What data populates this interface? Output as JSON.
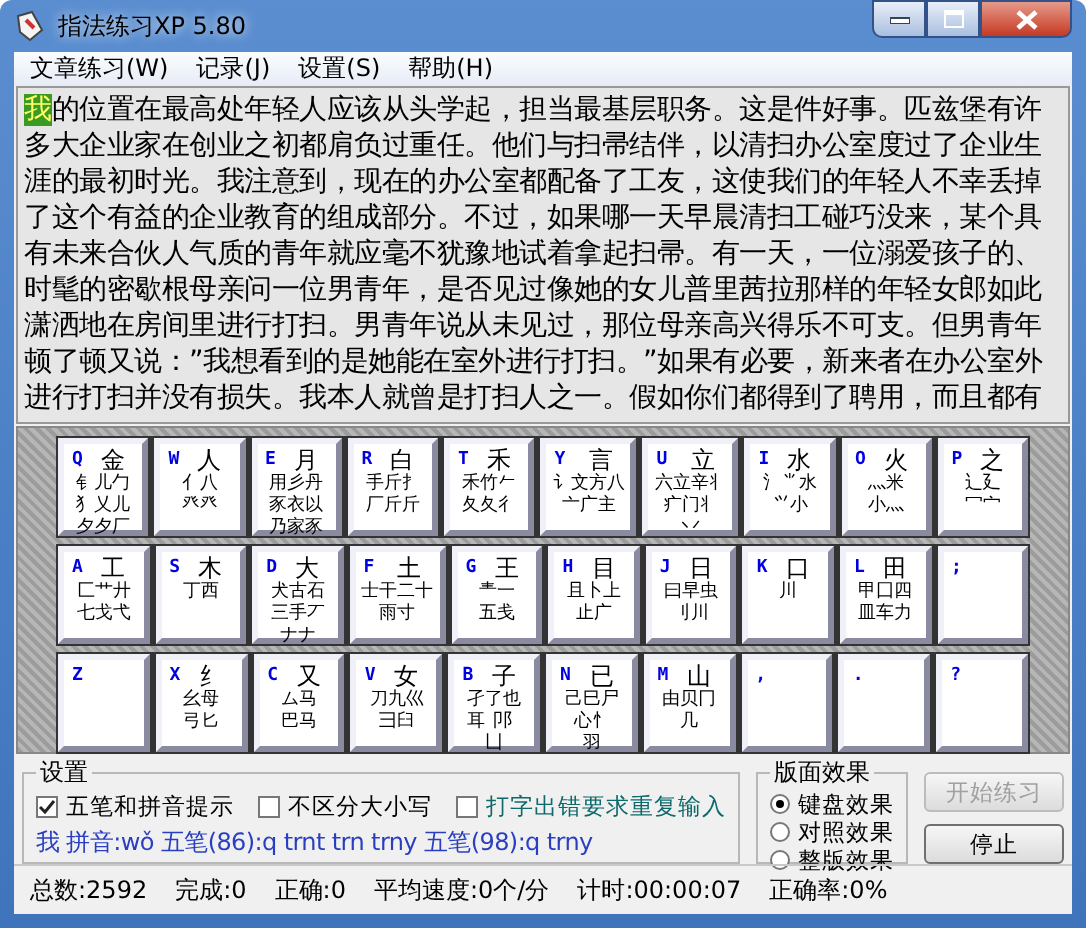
{
  "window": {
    "title": "指法练习XP 5.80"
  },
  "menu": [
    "文章练习(W)",
    "记录(J)",
    "设置(S)",
    "帮助(H)"
  ],
  "text": {
    "current": "我",
    "rest": "的位置在最高处年轻人应该从头学起，担当最基层职务。这是件好事。匹兹堡有许多大企业家在创业之初都肩负过重任。他们与扫帚结伴，以清扫办公室度过了企业生涯的最初时光。我注意到，现在的办公室都配备了工友，这使我们的年轻人不幸丢掉了这个有益的企业教育的组成部分。不过，如果哪一天早晨清扫工碰巧没来，某个具有未来合伙人气质的青年就应毫不犹豫地试着拿起扫帚。有一天，一位溺爱孩子的、时髦的密歇根母亲问一位男青年，是否见过像她的女儿普里茜拉那样的年轻女郎如此潇洒地在房间里进行打扫。男青年说从未见过，那位母亲高兴得乐不可支。但男青年顿了顿又说：”我想看到的是她能在室外进行打扫。”如果有必要，新来者在办公室外进行打扫并没有损失。我本人就曾是打扫人之一。假如你们都得到了聘用，而且都有"
  },
  "keyboard": [
    [
      {
        "key": "Q",
        "main": "金",
        "lines": [
          "钅儿勹",
          "犭乂儿",
          "夕夕厂"
        ]
      },
      {
        "key": "W",
        "main": "人",
        "lines": [
          "亻八",
          "癶癶"
        ]
      },
      {
        "key": "E",
        "main": "月",
        "lines": [
          "用彡丹",
          "豕衣以",
          "乃家豕"
        ]
      },
      {
        "key": "R",
        "main": "白",
        "lines": [
          "手斤扌",
          "厂斤斤"
        ]
      },
      {
        "key": "T",
        "main": "禾",
        "lines": [
          "禾竹𠂉",
          "夂夂彳"
        ]
      },
      {
        "key": "Y",
        "main": "言",
        "lines": [
          "讠文方八",
          "亠广主"
        ]
      },
      {
        "key": "U",
        "main": "立",
        "lines": [
          "六立辛丬",
          "疒门丬",
          "丷"
        ]
      },
      {
        "key": "I",
        "main": "水",
        "lines": [
          "氵⺌水",
          "⺍小"
        ]
      },
      {
        "key": "O",
        "main": "火",
        "lines": [
          "灬米",
          "小灬"
        ]
      },
      {
        "key": "P",
        "main": "之",
        "lines": [
          "辶廴",
          "冖宀"
        ]
      }
    ],
    [
      {
        "key": "A",
        "main": "工",
        "lines": [
          "匚艹廾",
          "七戈弋"
        ]
      },
      {
        "key": "S",
        "main": "木",
        "lines": [
          "丁西"
        ]
      },
      {
        "key": "D",
        "main": "大",
        "lines": [
          "犬古石",
          "三手丆",
          "ナナ"
        ]
      },
      {
        "key": "F",
        "main": "土",
        "lines": [
          "士干二十",
          "雨寸"
        ]
      },
      {
        "key": "G",
        "main": "王",
        "lines": [
          "龶一",
          "五戋"
        ]
      },
      {
        "key": "H",
        "main": "目",
        "lines": [
          "且卜上",
          "止广"
        ]
      },
      {
        "key": "J",
        "main": "日",
        "lines": [
          "曰早虫",
          "刂川"
        ]
      },
      {
        "key": "K",
        "main": "口",
        "lines": [
          "川"
        ]
      },
      {
        "key": "L",
        "main": "田",
        "lines": [
          "甲囗四",
          "皿车力"
        ]
      },
      {
        "key": ";"
      }
    ],
    [
      {
        "key": "Z"
      },
      {
        "key": "X",
        "main": "纟",
        "lines": [
          "幺母",
          "弓匕"
        ]
      },
      {
        "key": "C",
        "main": "又",
        "lines": [
          "ム马",
          "巴马"
        ]
      },
      {
        "key": "V",
        "main": "女",
        "lines": [
          "刀九巛",
          "彐臼"
        ]
      },
      {
        "key": "B",
        "main": "子",
        "lines": [
          "孑了也",
          "耳卩阝",
          "凵"
        ]
      },
      {
        "key": "N",
        "main": "已",
        "lines": [
          "己巳尸",
          "心忄",
          "羽"
        ]
      },
      {
        "key": "M",
        "main": "山",
        "lines": [
          "由贝冂",
          "几"
        ]
      },
      {
        "key": ","
      },
      {
        "key": "."
      },
      {
        "key": "?"
      }
    ]
  ],
  "settings": {
    "title": "设置",
    "options": [
      {
        "label": "五笔和拼音提示",
        "checked": true,
        "kind": "plain"
      },
      {
        "label": "不区分大小写",
        "checked": false,
        "kind": "plain"
      },
      {
        "label": "打字出错要求重复输入",
        "checked": false,
        "kind": "accent"
      }
    ],
    "hint": "我 拼音:wǒ 五笔(86):q trnt trn trny 五笔(98):q trny"
  },
  "effects": {
    "title": "版面效果",
    "options": [
      {
        "label": "键盘效果",
        "selected": true
      },
      {
        "label": "对照效果",
        "selected": false
      },
      {
        "label": "整版效果",
        "selected": false
      }
    ]
  },
  "buttons": [
    {
      "label": "开始练习",
      "disabled": true
    },
    {
      "label": "停止",
      "disabled": false
    }
  ],
  "status_bar": [
    "总数:2592",
    "完成:0",
    "正确:0",
    "平均速度:0个/分",
    "计时:00:00:07",
    "正确率:0%"
  ]
}
